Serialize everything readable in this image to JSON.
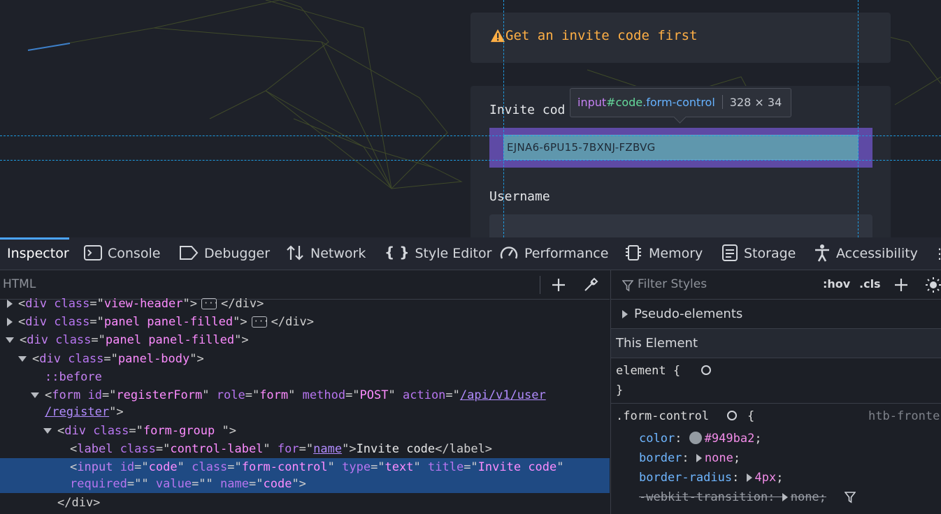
{
  "page": {
    "alert_text": "Get an invite code first",
    "invite_label": "Invite cod",
    "code_value": "EJNA6-6PU15-7BXNJ-FZBVG",
    "username_label": "Username"
  },
  "tooltip": {
    "tag": "input",
    "id": "#code",
    "cls": ".form-control",
    "dims": "328 × 34"
  },
  "devtools": {
    "tabs": [
      "Inspector",
      "Console",
      "Debugger",
      "Network",
      "Style Editor",
      "Performance",
      "Memory",
      "Storage",
      "Accessibility"
    ],
    "html_search_placeholder": "HTML",
    "filter_placeholder": "Filter Styles",
    "hov": ":hov",
    "cls": ".cls",
    "pseudo_elements": "Pseudo-elements",
    "this_element": "This Element",
    "element_rule": "element {",
    "close_brace": "}",
    "form_control_selector": ".form-control",
    "open_brace": "{",
    "source": "htb-fronte",
    "props": [
      {
        "name": "color",
        "value": "#949ba2"
      },
      {
        "name": "border",
        "value": "none"
      },
      {
        "name": "border-radius",
        "value": "4px"
      },
      {
        "name": "-webkit-transition",
        "value": "none"
      }
    ],
    "swatch_color": "#949ba2"
  },
  "tree": {
    "r0_tag": "div",
    "r0_cls": "view-header",
    "r1_tag": "div",
    "r1_cls": "panel panel-filled",
    "r2_tag": "div",
    "r2_cls": "panel panel-filled",
    "r3_tag": "div",
    "r3_cls": "panel-body",
    "r4": "::before",
    "r5_id": "registerForm",
    "r5_role": "form",
    "r5_method": "POST",
    "r5_action_a": "/api/v1/user",
    "r5_action_b": "/register",
    "r6_cls": "form-group ",
    "r7_cls": "control-label",
    "r7_for": "name",
    "r7_text": "Invite code",
    "r8_id": "code",
    "r8_cls": "form-control",
    "r8_type": "text",
    "r8_title": "Invite code",
    "r8_required": "",
    "r8_value": "",
    "r8_name": "code",
    "r9": "</div>"
  }
}
